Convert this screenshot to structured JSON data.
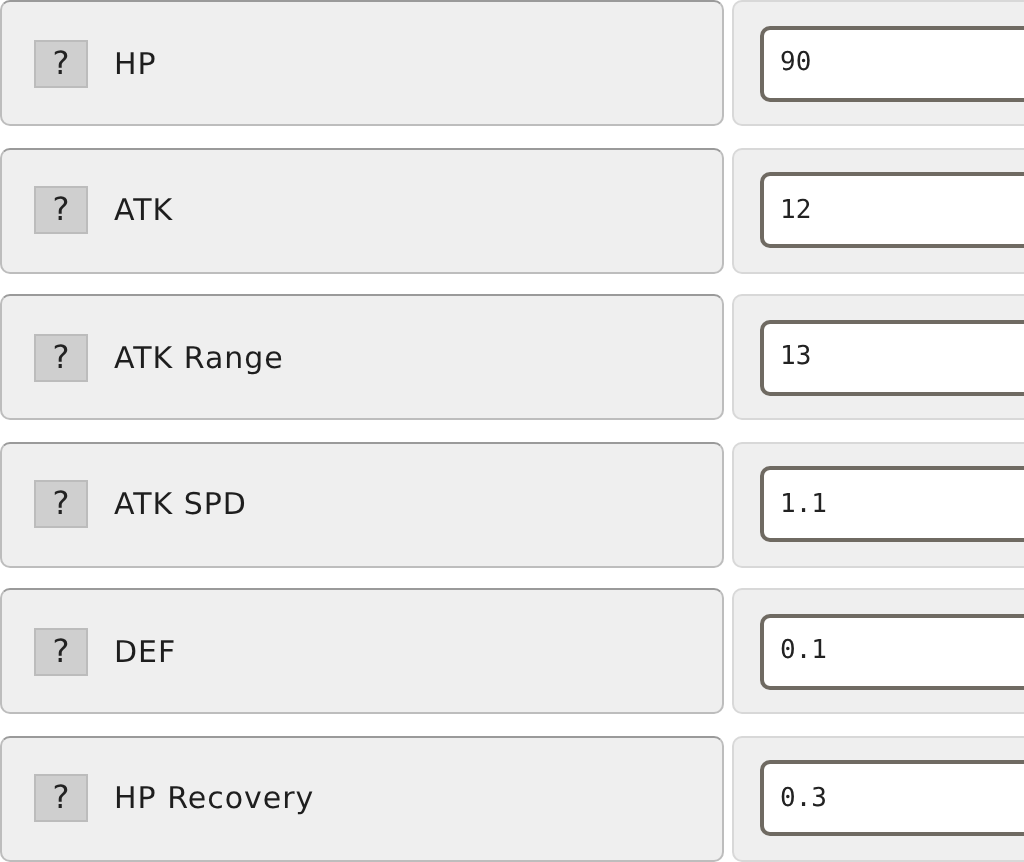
{
  "stats": [
    {
      "label": "HP",
      "help": "?",
      "value": "90"
    },
    {
      "label": "ATK",
      "help": "?",
      "value": "12"
    },
    {
      "label": "ATK Range",
      "help": "?",
      "value": "13"
    },
    {
      "label": "ATK SPD",
      "help": "?",
      "value": "1.1"
    },
    {
      "label": "DEF",
      "help": "?",
      "value": "0.1"
    },
    {
      "label": "HP Recovery",
      "help": "?",
      "value": "0.3"
    }
  ]
}
